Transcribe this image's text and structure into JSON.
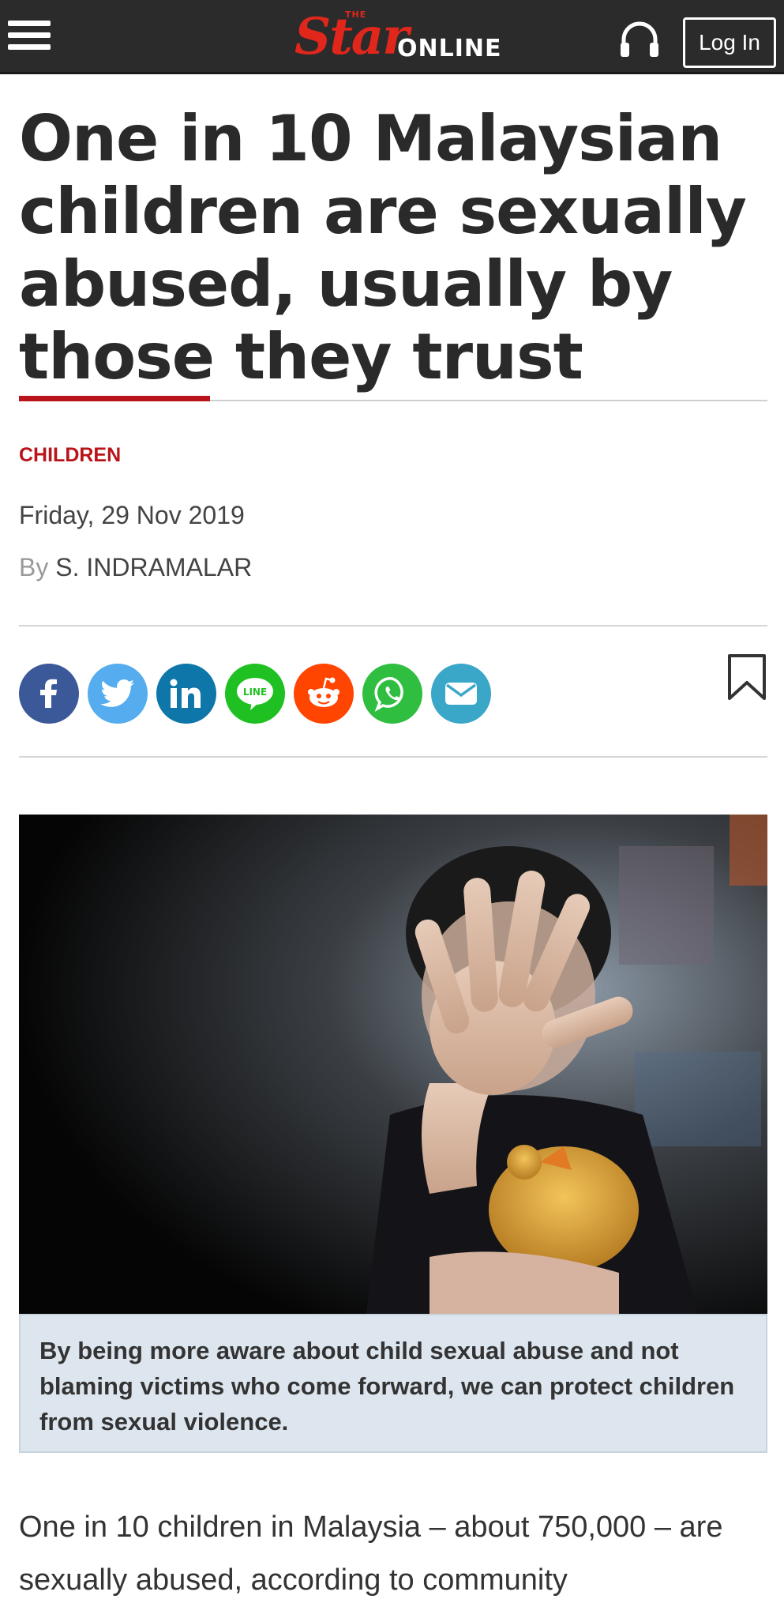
{
  "header": {
    "logo_the": "THE",
    "logo_star": "Star",
    "logo_online": "ONLINE",
    "login_label": "Log In",
    "menu_icon": "hamburger-icon",
    "audio_icon": "headphones-icon",
    "background_color": "#2b2b2b",
    "brand_color": "#e1261c"
  },
  "article": {
    "headline": "One in 10 Malaysian children are sexually abused, usually by those they trust",
    "category": "CHILDREN",
    "date": "Friday, 29 Nov 2019",
    "byline_prefix": "By ",
    "author": "S. INDRAMALAR",
    "accent_color": "#b9141a",
    "share_buttons": [
      {
        "name": "facebook",
        "icon": "facebook-icon",
        "color": "#3b5998"
      },
      {
        "name": "twitter",
        "icon": "twitter-icon",
        "color": "#55acee"
      },
      {
        "name": "linkedin",
        "icon": "linkedin-icon",
        "color": "#0e76a8"
      },
      {
        "name": "line",
        "icon": "line-icon",
        "label": "LINE",
        "color": "#1ec121"
      },
      {
        "name": "reddit",
        "icon": "reddit-icon",
        "color": "#ff4500"
      },
      {
        "name": "whatsapp",
        "icon": "whatsapp-icon",
        "color": "#2fbe40"
      },
      {
        "name": "email",
        "icon": "email-icon",
        "color": "#3aa7c9"
      }
    ],
    "bookmark_icon": "bookmark-icon",
    "image_caption": "By being more aware about child sexual abuse and not blaming victims who come forward, we can protect children from sexual violence.",
    "body_intro": "One in 10 children in Malaysia – about 750,000 – are sexually abused, according to community"
  }
}
